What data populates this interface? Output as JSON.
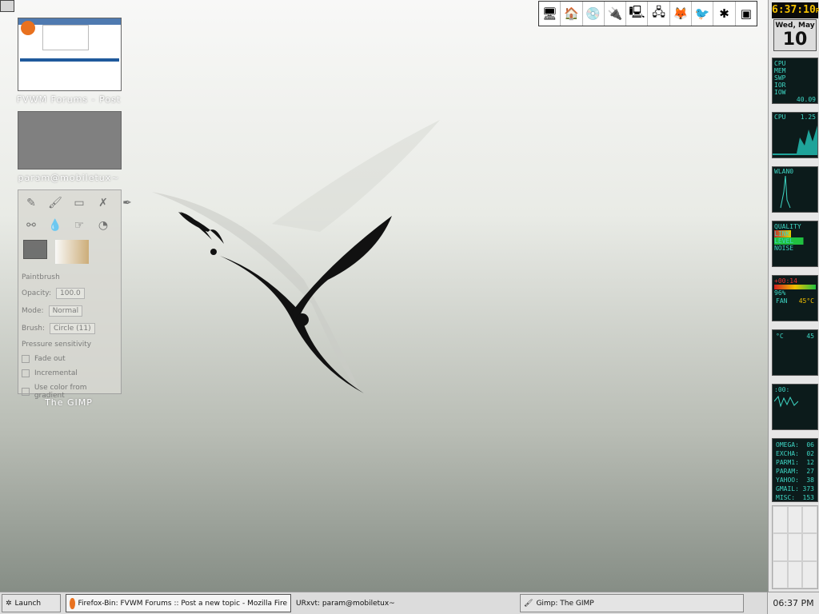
{
  "desktop": {
    "minimized_windows": [
      {
        "label": "FVWM Forums - Post",
        "kind": "firefox"
      },
      {
        "label": "param@mobiletux~",
        "kind": "terminal"
      },
      {
        "label": "The GIMP",
        "kind": "gimp"
      }
    ],
    "gimp": {
      "tool_name": "Paintbrush",
      "opacity_label": "Opacity:",
      "opacity_value": "100.0",
      "mode_label": "Mode:",
      "mode_value": "Normal",
      "brush_label": "Brush:",
      "brush_value": "Circle (11)",
      "pressure": "Pressure sensitivity",
      "fade": "Fade out",
      "incremental": "Incremental",
      "gradient": "Use color from gradient"
    }
  },
  "launcher": {
    "icons": [
      "computer-icon",
      "home-icon",
      "cdrom-icon",
      "plug-icon",
      "monitor-icon",
      "network-icon",
      "firefox-icon",
      "thunderbird-icon",
      "gimp-icon",
      "terminal-icon"
    ]
  },
  "dock": {
    "clock": "6:37:10",
    "clock_suffix": "P",
    "date_day": "Wed, May",
    "date_num": "10",
    "sysmon": {
      "labels": [
        "CPU",
        "MEM",
        "SWP",
        "IOR",
        "IOW"
      ],
      "value": "40.09"
    },
    "cpu": {
      "label": "CPU",
      "value": "1.25"
    },
    "wlan": {
      "label": "WLAN0"
    },
    "quality": {
      "label": "QUALITY",
      "rows": [
        "LINK",
        "LEVEL",
        "NOISE"
      ]
    },
    "battery": {
      "time": "+00:14",
      "percent": "96%",
      "fan_label": "FAN",
      "fan_value": "45°C"
    },
    "temp": {
      "unit": "°C",
      "value": "45"
    },
    "mixer": {
      "value": ":00:"
    },
    "mail": [
      {
        "name": "OMEGA:",
        "count": "06"
      },
      {
        "name": "EXCHA:",
        "count": "02"
      },
      {
        "name": "PARM1:",
        "count": "12"
      },
      {
        "name": "PARAM:",
        "count": "27"
      },
      {
        "name": "YAHOO:",
        "count": "38"
      },
      {
        "name": "GMAIL:",
        "count": "373"
      },
      {
        "name": "MISC:",
        "count": "153"
      }
    ]
  },
  "taskbar": {
    "launch": "Launch",
    "tasks": [
      "Firefox-Bin: FVWM Forums :: Post a new topic - Mozilla Fire",
      "URxvt: param@mobiletux~",
      "Gimp: The GIMP"
    ],
    "clock": "06:37 PM"
  }
}
